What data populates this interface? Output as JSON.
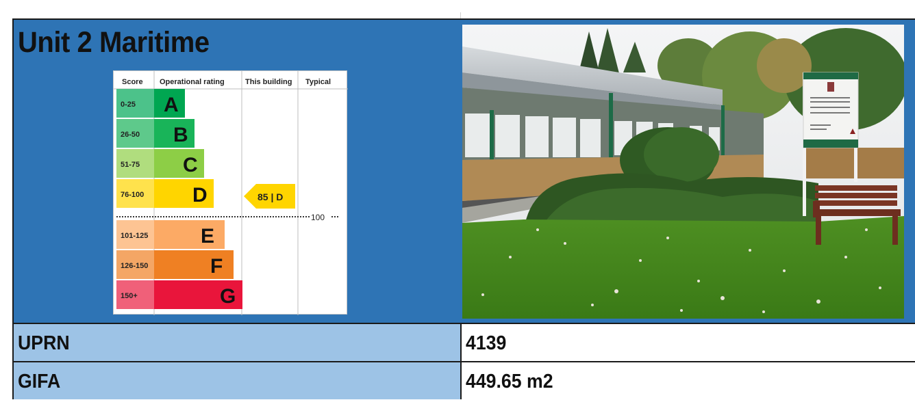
{
  "title": "Unit 2 Maritime",
  "epc": {
    "headers": {
      "score": "Score",
      "rating": "Operational rating",
      "building": "This building",
      "typical": "Typical"
    },
    "bands": [
      {
        "range": "0-25",
        "letter": "A",
        "color": "#00a651",
        "light": "#4cc28a"
      },
      {
        "range": "26-50",
        "letter": "B",
        "color": "#19b459",
        "light": "#5ec98b"
      },
      {
        "range": "51-75",
        "letter": "C",
        "color": "#8dce46",
        "light": "#b0dd7e"
      },
      {
        "range": "76-100",
        "letter": "D",
        "color": "#ffd500",
        "light": "#ffe24c"
      },
      {
        "range": "101-125",
        "letter": "E",
        "color": "#fcaa65",
        "light": "#fdc493"
      },
      {
        "range": "126-150",
        "letter": "F",
        "color": "#ef8023",
        "light": "#f4a665"
      },
      {
        "range": "150+",
        "letter": "G",
        "color": "#e9153b",
        "light": "#f06079"
      }
    ],
    "building_rating": {
      "value": 85,
      "letter": "D",
      "label": "85 | D"
    },
    "typical_marker": "100"
  },
  "photo": {
    "description_icon": "building-photo"
  },
  "table": {
    "rows": [
      {
        "label": "UPRN",
        "value": "4139"
      },
      {
        "label": "GIFA",
        "value": "449.65 m2"
      }
    ]
  }
}
